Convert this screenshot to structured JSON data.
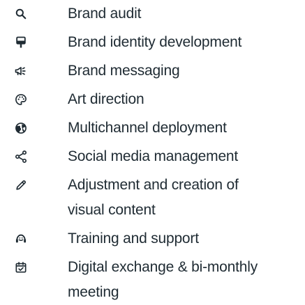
{
  "icon_color": "#1f2b33",
  "items": [
    {
      "icon": "search-icon",
      "label": "Brand audit"
    },
    {
      "icon": "brand-identity-icon",
      "label": "Brand identity development"
    },
    {
      "icon": "megaphone-icon",
      "label": "Brand messaging"
    },
    {
      "icon": "palette-icon",
      "label": "Art direction"
    },
    {
      "icon": "globe-icon",
      "label": "Multichannel deployment"
    },
    {
      "icon": "share-icon",
      "label": "Social media management"
    },
    {
      "icon": "pencil-icon",
      "label": "Adjustment and creation of visual content"
    },
    {
      "icon": "support-icon",
      "label": "Training and support"
    },
    {
      "icon": "calendar-check-icon",
      "label": "Digital exchange & bi-monthly meeting"
    }
  ]
}
